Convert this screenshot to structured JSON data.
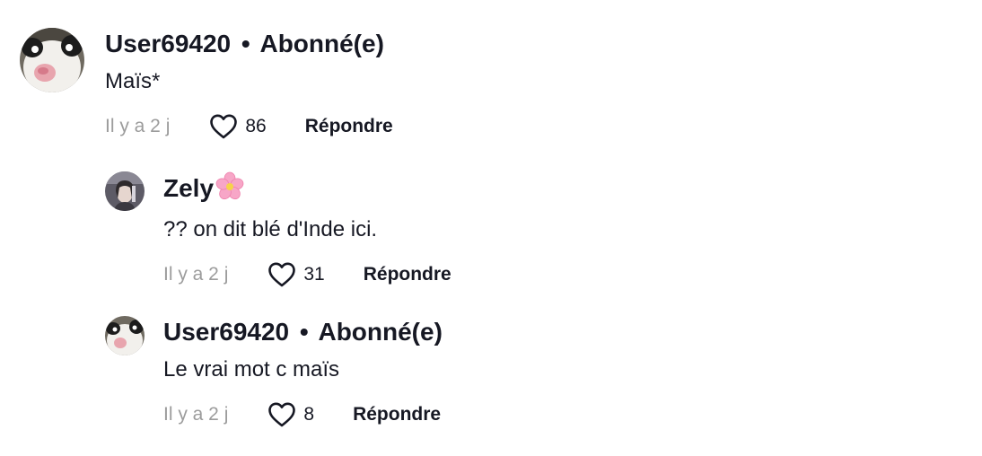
{
  "comments": [
    {
      "author": "User69420",
      "separator": "•",
      "tag": "Abonné(e)",
      "text": "Maïs*",
      "time": "Il y a 2 j",
      "likes": "86",
      "reply_label": "Répondre",
      "avatar_icon": "cat-avatar-icon"
    },
    {
      "author": "Zely",
      "emoji_icon": "cherry-blossom-icon",
      "text": "?? on dit blé d'Inde ici.",
      "time": "Il y a 2 j",
      "likes": "31",
      "reply_label": "Répondre",
      "avatar_icon": "person-avatar-icon"
    },
    {
      "author": "User69420",
      "separator": "•",
      "tag": "Abonné(e)",
      "text": "Le vrai mot c maïs",
      "time": "Il y a 2 j",
      "likes": "8",
      "reply_label": "Répondre",
      "avatar_icon": "cat-avatar-icon"
    }
  ],
  "colors": {
    "text": "#161823",
    "muted": "#9c9c9c"
  }
}
